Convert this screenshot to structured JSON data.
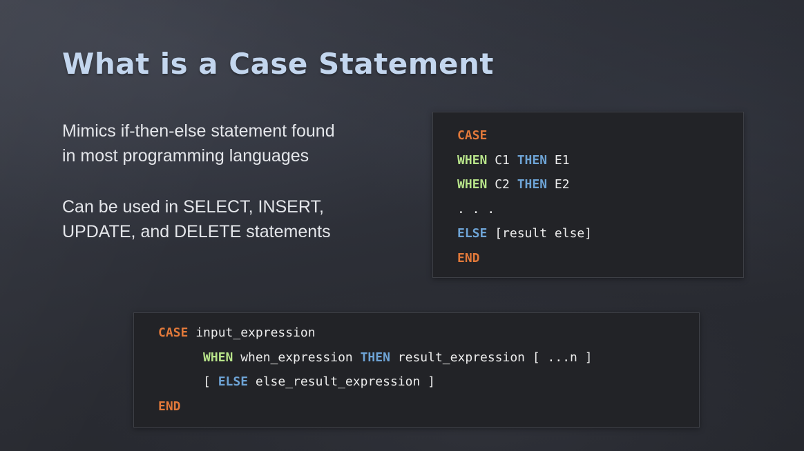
{
  "slide": {
    "title": "What is a Case Statement",
    "bullets": [
      {
        "line1": "Mimics if-then-else statement found",
        "line2": "in most programming languages"
      },
      {
        "line1": "Can be used in SELECT, INSERT,",
        "line2": "UPDATE, and DELETE statements"
      }
    ]
  },
  "colors": {
    "keyword_orange": "#e2793a",
    "keyword_green": "#b8e48a",
    "keyword_blue": "#6ea4d6",
    "title": "#c3d6ee"
  },
  "syntax_box": {
    "line1": {
      "kw": "CASE"
    },
    "line2": {
      "when": "WHEN",
      "cond": " C1 ",
      "then": "THEN",
      "expr": " E1"
    },
    "line3": {
      "when": "WHEN",
      "cond": " C2 ",
      "then": "THEN",
      "expr": " E2"
    },
    "line4": {
      "text": ". . ."
    },
    "line5": {
      "else": "ELSE",
      "text": " [result else]"
    },
    "line6": {
      "kw": "END"
    }
  },
  "full_syntax_box": {
    "line1": {
      "kw": "CASE",
      "text": " input_expression"
    },
    "line2": {
      "when": "WHEN",
      "text1": " when_expression ",
      "then": "THEN",
      "text2": " result_expression [ ...n ]"
    },
    "line3": {
      "open": "[ ",
      "else": "ELSE",
      "text": " else_result_expression ]"
    },
    "line4": {
      "kw": "END"
    }
  }
}
